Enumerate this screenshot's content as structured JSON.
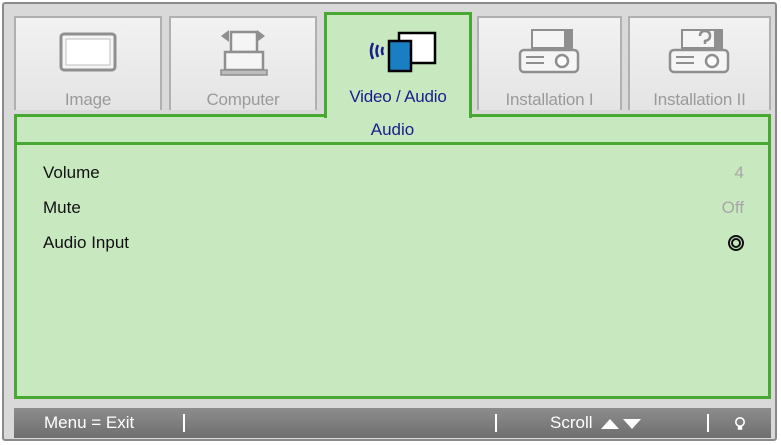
{
  "tabs": [
    {
      "label": "Image",
      "icon": "monitor-icon",
      "active": false
    },
    {
      "label": "Computer",
      "icon": "computer-icon",
      "active": false
    },
    {
      "label": "Video / Audio",
      "icon": "video-audio-icon",
      "active": true
    },
    {
      "label": "Installation I",
      "icon": "projector-icon",
      "active": false
    },
    {
      "label": "Installation II",
      "icon": "projector-settings-icon",
      "active": false
    }
  ],
  "section": {
    "title": "Audio"
  },
  "settings": [
    {
      "name": "Volume",
      "value": "4"
    },
    {
      "name": "Mute",
      "value": "Off"
    },
    {
      "name": "Audio Input",
      "value_icon": "submenu-target-icon"
    }
  ],
  "statusbar": {
    "menu_exit": "Menu = Exit",
    "scroll": "Scroll",
    "scroll_icons": "up-down-arrow-icons",
    "help_icon": "lightbulb-icon"
  },
  "colors": {
    "accent_green": "#47a832",
    "panel_bg": "#c8e8c0",
    "active_text": "#1b1e8a",
    "inactive_text": "#9a9a9a",
    "status_bg": "#7d7d7d"
  }
}
